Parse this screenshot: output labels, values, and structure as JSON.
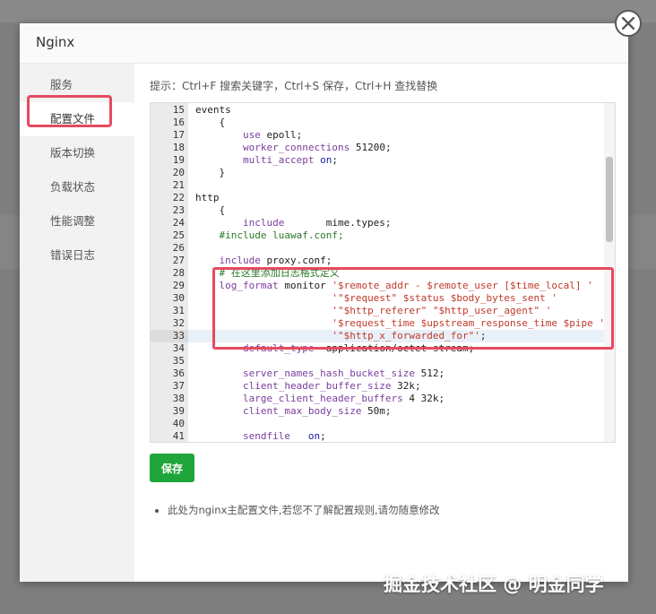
{
  "modal": {
    "title": "Nginx"
  },
  "sidebar": {
    "items": [
      {
        "label": "服务"
      },
      {
        "label": "配置文件",
        "active": true
      },
      {
        "label": "版本切换"
      },
      {
        "label": "负载状态"
      },
      {
        "label": "性能调整"
      },
      {
        "label": "错误日志"
      }
    ]
  },
  "content": {
    "tip": "提示：Ctrl+F 搜索关键字，Ctrl+S 保存，Ctrl+H 查找替换",
    "save_label": "保存",
    "note": "此处为nginx主配置文件,若您不了解配置规则,请勿随意修改"
  },
  "editor": {
    "active_line": 33,
    "lines": [
      {
        "n": "15",
        "text": "events"
      },
      {
        "n": "16",
        "text": "    {"
      },
      {
        "n": "17",
        "text": "        use epoll;"
      },
      {
        "n": "18",
        "text": "        worker_connections 51200;"
      },
      {
        "n": "19",
        "text": "        multi_accept on;"
      },
      {
        "n": "20",
        "text": "    }"
      },
      {
        "n": "21",
        "text": ""
      },
      {
        "n": "22",
        "text": "http"
      },
      {
        "n": "23",
        "text": "    {"
      },
      {
        "n": "24",
        "text": "        include       mime.types;"
      },
      {
        "n": "25",
        "text": "    #include luawaf.conf;"
      },
      {
        "n": "26",
        "text": ""
      },
      {
        "n": "27",
        "text": "    include proxy.conf;"
      },
      {
        "n": "28",
        "text": "    # 在这里添加日志格式定义"
      },
      {
        "n": "29",
        "text": "    log_format monitor '$remote_addr - $remote_user [$time_local] '"
      },
      {
        "n": "30",
        "text": "                       '\"$request\" $status $body_bytes_sent '"
      },
      {
        "n": "31",
        "text": "                       '\"$http_referer\" \"$http_user_agent\" '"
      },
      {
        "n": "32",
        "text": "                       '$request_time $upstream_response_time $pipe '"
      },
      {
        "n": "33",
        "text": "                       '\"$http_x_forwarded_for\"';"
      },
      {
        "n": "34",
        "text": "        default_type  application/octet-stream;"
      },
      {
        "n": "35",
        "text": ""
      },
      {
        "n": "36",
        "text": "        server_names_hash_bucket_size 512;"
      },
      {
        "n": "37",
        "text": "        client_header_buffer_size 32k;"
      },
      {
        "n": "38",
        "text": "        large_client_header_buffers 4 32k;"
      },
      {
        "n": "39",
        "text": "        client_max_body_size 50m;"
      },
      {
        "n": "40",
        "text": ""
      },
      {
        "n": "41",
        "text": "        sendfile   on;"
      }
    ]
  },
  "watermark": "掘金技术社区 @ 明金同学",
  "colors": {
    "accent": "#20a53a",
    "highlight": "#e64a5f"
  },
  "icons": {
    "close": "close-icon"
  }
}
